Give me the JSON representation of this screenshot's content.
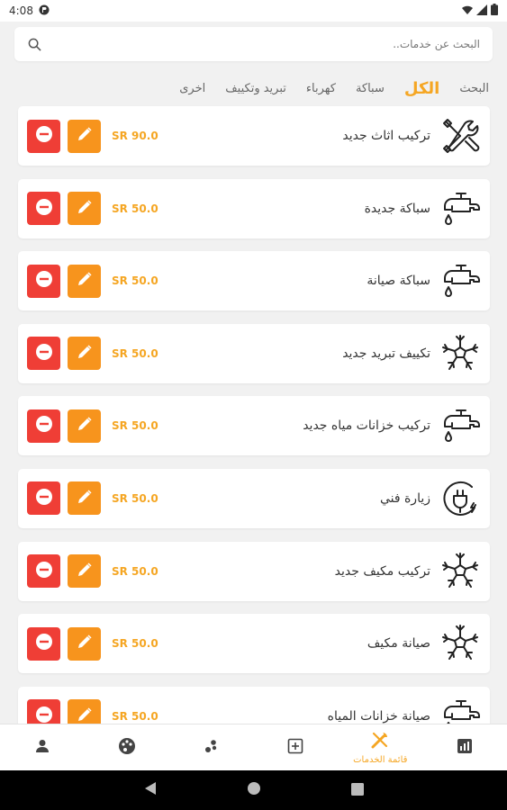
{
  "status_bar": {
    "time": "4:08"
  },
  "search": {
    "placeholder": "البحث عن خدمات.."
  },
  "tabs": [
    {
      "label": "البحث",
      "active": false
    },
    {
      "label": "الكل",
      "active": true
    },
    {
      "label": "سباكة",
      "active": false
    },
    {
      "label": "كهرباء",
      "active": false
    },
    {
      "label": "تبريد وتكييف",
      "active": false
    },
    {
      "label": "اخرى",
      "active": false
    }
  ],
  "services": [
    {
      "name": "تركيب اثاث جديد",
      "price": "SR 90.0",
      "icon": "tools-icon"
    },
    {
      "name": "سباكة جديدة",
      "price": "SR 50.0",
      "icon": "faucet-icon"
    },
    {
      "name": "سباكة صيانة",
      "price": "SR 50.0",
      "icon": "faucet-icon"
    },
    {
      "name": "تكييف تبريد جديد",
      "price": "SR 50.0",
      "icon": "snowflake-icon"
    },
    {
      "name": "تركيب خزانات مياه جديد",
      "price": "SR 50.0",
      "icon": "faucet-icon"
    },
    {
      "name": "زيارة فني",
      "price": "SR 50.0",
      "icon": "plug-icon"
    },
    {
      "name": "تركيب مكيف جديد",
      "price": "SR 50.0",
      "icon": "snowflake-icon"
    },
    {
      "name": "صيانة مكيف",
      "price": "SR 50.0",
      "icon": "snowflake-icon"
    },
    {
      "name": "صيانة خزانات المياه",
      "price": "SR 50.0",
      "icon": "faucet-icon"
    }
  ],
  "bottom_nav": {
    "items": [
      {
        "icon": "stats-icon",
        "label": ""
      },
      {
        "icon": "services-list-icon",
        "label": "قائمة الخدمات",
        "active": true
      },
      {
        "icon": "add-box-icon",
        "label": ""
      },
      {
        "icon": "bubbles-icon",
        "label": ""
      },
      {
        "icon": "palette-icon",
        "label": ""
      },
      {
        "icon": "profile-icon",
        "label": ""
      }
    ]
  },
  "colors": {
    "accent": "#f5a623",
    "edit": "#f7941d",
    "delete": "#ef3e36"
  }
}
